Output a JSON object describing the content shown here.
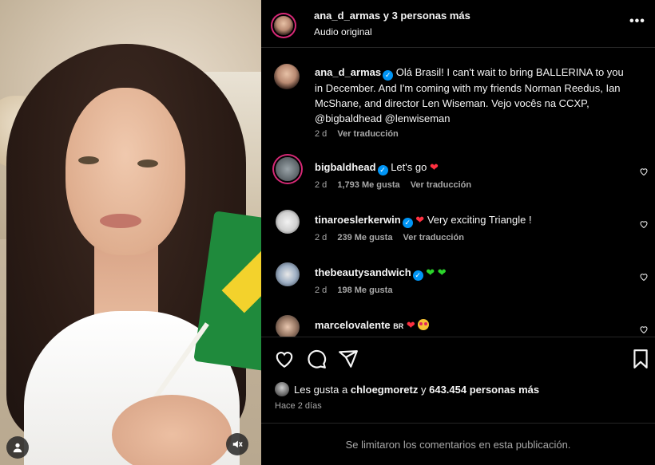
{
  "header": {
    "title": "ana_d_armas y 3 personas más",
    "subtitle": "Audio original"
  },
  "caption": {
    "username": "ana_d_armas",
    "text": "Olá Brasil! I can't wait to bring BALLERINA to you in December. And I'm coming with my friends Norman Reedus, Ian McShane, and director Len Wiseman. Vejo vocês na CCXP, @bigbaldhead @lenwiseman",
    "time": "2 d",
    "translate": "Ver traducción"
  },
  "comments": [
    {
      "username": "bigbaldhead",
      "verified": true,
      "text": "Let's go",
      "emoji": "red-heart",
      "time": "2 d",
      "likes": "1,793 Me gusta",
      "translate": "Ver traducción"
    },
    {
      "username": "tinaroeslerkerwin",
      "verified": true,
      "text": "Very exciting Triangle !",
      "emoji": "red-heart",
      "time": "2 d",
      "likes": "239 Me gusta",
      "translate": "Ver traducción"
    },
    {
      "username": "thebeautysandwich",
      "verified": true,
      "text": "",
      "emoji": "green-hearts",
      "time": "2 d",
      "likes": "198 Me gusta"
    },
    {
      "username": "marcelovalente",
      "verified": false,
      "badge": "BR",
      "text": "",
      "emoji": "red-heart-and-star-eyes"
    }
  ],
  "likes": {
    "prefix": "Les gusta a",
    "user": "chloegmoretz",
    "joiner": "y",
    "others": "643.454 personas más"
  },
  "posted": "Hace 2 días",
  "footer": "Se limitaron los comentarios en esta publicación.",
  "colors": {
    "background": "#000000",
    "text": "#f5f5f5",
    "secondary_text": "#a8a8a8",
    "verified": "#0095f6",
    "heart_red": "#ff3040",
    "heart_green": "#2bd42b",
    "divider": "#262626"
  },
  "icons": [
    "more-options-icon",
    "like-icon",
    "comment-icon",
    "share-icon",
    "save-icon",
    "user-tag-icon",
    "mute-icon"
  ]
}
